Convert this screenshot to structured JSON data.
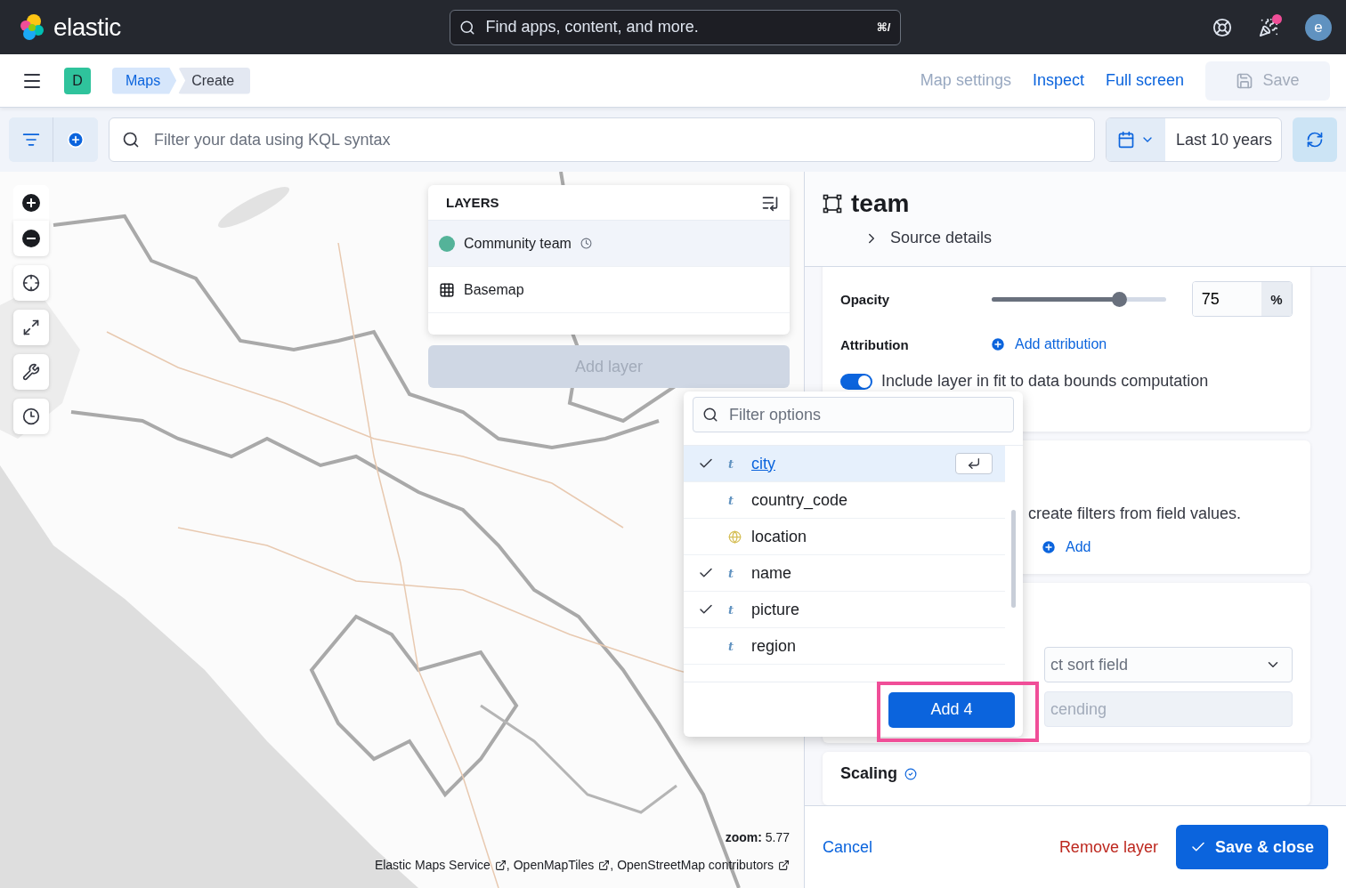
{
  "header": {
    "brand": "elastic",
    "search": {
      "placeholder": "Find apps, content, and more.",
      "shortcut": "⌘/"
    },
    "news_unread": true,
    "avatar": "e"
  },
  "nav": {
    "space": "D",
    "breadcrumbs": [
      {
        "label": "Maps",
        "selected": false
      },
      {
        "label": "Create",
        "selected": true
      }
    ],
    "actions": [
      {
        "label": "Map settings",
        "disabled": true
      },
      {
        "label": "Inspect",
        "disabled": false
      },
      {
        "label": "Full screen",
        "disabled": false
      }
    ],
    "save": {
      "label": "Save",
      "disabled": true
    }
  },
  "query": {
    "placeholder": "Filter your data using KQL syntax",
    "date_range": "Last 10 years"
  },
  "map": {
    "zoom_label": "zoom:",
    "zoom_value": "5.77",
    "attribution": [
      {
        "label": "Elastic Maps Service"
      },
      {
        "label": "OpenMapTiles",
        "prefix": ","
      },
      {
        "label": "OpenStreetMap contributors",
        "prefix": ","
      }
    ]
  },
  "layers": {
    "title": "LAYERS",
    "items": [
      {
        "name": "Community team",
        "kind": "vector",
        "color": "#54b399",
        "selected": true
      },
      {
        "name": "Basemap",
        "kind": "basemap",
        "selected": false
      }
    ],
    "add_layer": {
      "label": "Add layer",
      "disabled": true
    }
  },
  "panel": {
    "title": "team",
    "source_details": {
      "label": "Source details",
      "expanded": false
    },
    "opacity": {
      "label": "Opacity",
      "level": 0.73,
      "value": "75",
      "unit": "%"
    },
    "attribution": {
      "label": "Attribution",
      "action": "Add attribution"
    },
    "fit_bounds": {
      "label": "Include layer in fit to data bounds computation",
      "on": true
    },
    "filters_card": {
      "text": "create filters from field values.",
      "action": "Add"
    },
    "sort_card": {
      "select": "ct sort field",
      "order": "cending"
    },
    "scaling": {
      "title": "Scaling"
    },
    "footer": {
      "cancel": "Cancel",
      "remove": "Remove layer",
      "save": "Save & close"
    }
  },
  "field_picker": {
    "placeholder": "Filter options",
    "items": [
      {
        "label": "city",
        "kind": "string",
        "token": "t",
        "checked": true,
        "focused": true
      },
      {
        "label": "country_code",
        "kind": "string",
        "token": "t",
        "checked": false,
        "focused": false
      },
      {
        "label": "location",
        "kind": "geo",
        "checked": false,
        "focused": false
      },
      {
        "label": "name",
        "kind": "string",
        "token": "t",
        "checked": true,
        "focused": false
      },
      {
        "label": "picture",
        "kind": "string",
        "token": "t",
        "checked": true,
        "focused": false
      },
      {
        "label": "region",
        "kind": "string",
        "token": "t",
        "checked": false,
        "focused": false
      }
    ],
    "add": {
      "label": "Add 4",
      "highlighted": true
    }
  }
}
